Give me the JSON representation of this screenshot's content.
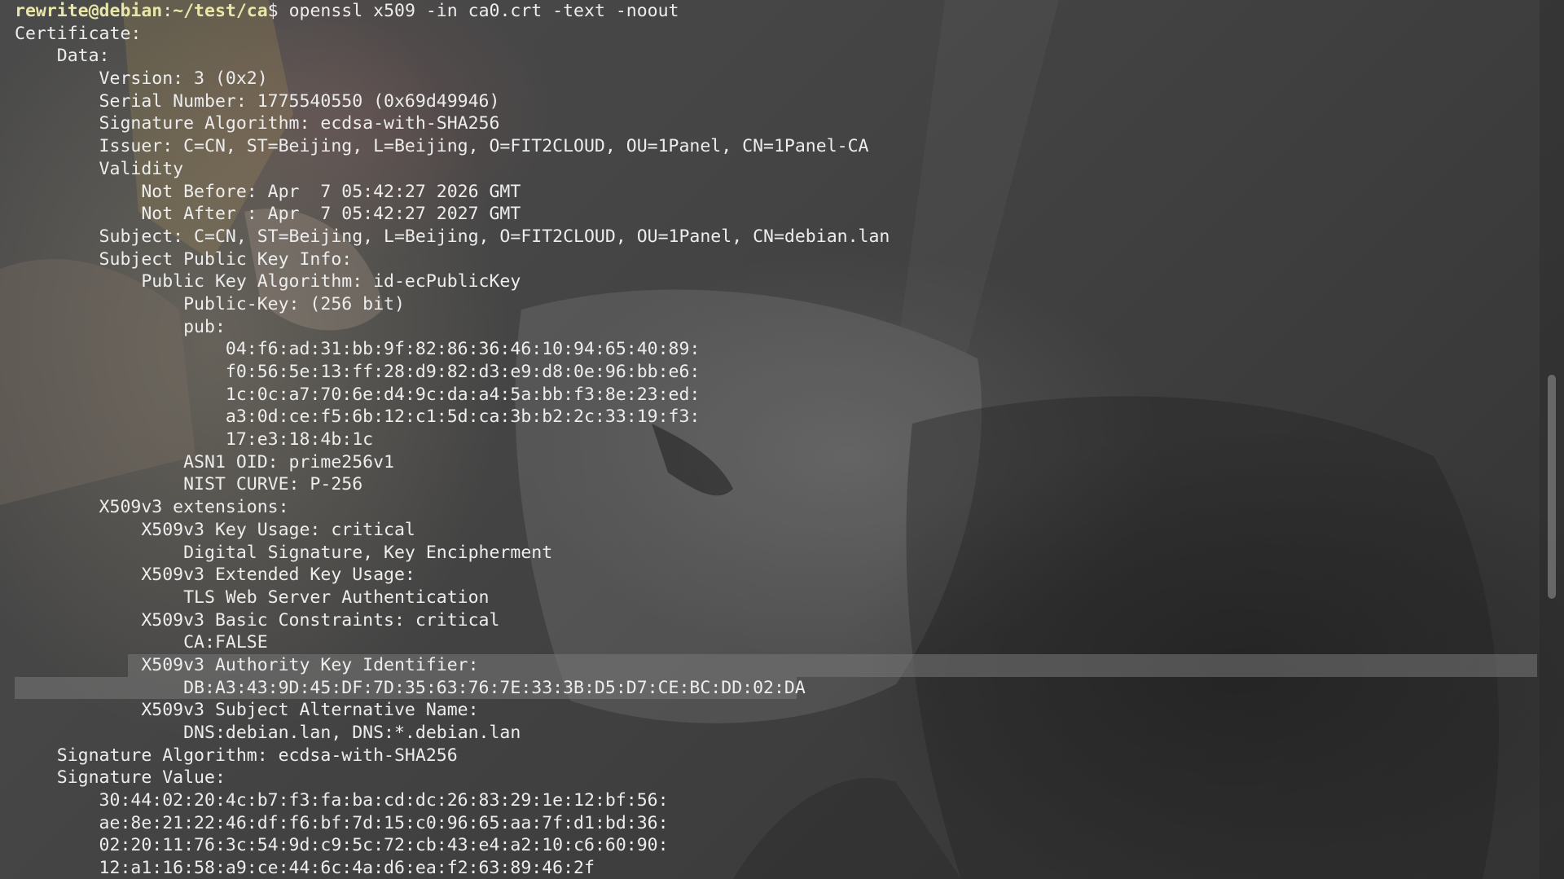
{
  "prompt": {
    "user_host": "rewrite@debian",
    "separator": ":",
    "path": "~/test/ca",
    "symbol": "$",
    "command": " openssl x509 -in ca0.crt -text -noout"
  },
  "output_lines": [
    "Certificate:",
    "    Data:",
    "        Version: 3 (0x2)",
    "        Serial Number: 1775540550 (0x69d49946)",
    "        Signature Algorithm: ecdsa-with-SHA256",
    "        Issuer: C=CN, ST=Beijing, L=Beijing, O=FIT2CLOUD, OU=1Panel, CN=1Panel-CA",
    "        Validity",
    "            Not Before: Apr  7 05:42:27 2026 GMT",
    "            Not After : Apr  7 05:42:27 2027 GMT",
    "        Subject: C=CN, ST=Beijing, L=Beijing, O=FIT2CLOUD, OU=1Panel, CN=debian.lan",
    "        Subject Public Key Info:",
    "            Public Key Algorithm: id-ecPublicKey",
    "                Public-Key: (256 bit)",
    "                pub:",
    "                    04:f6:ad:31:bb:9f:82:86:36:46:10:94:65:40:89:",
    "                    f0:56:5e:13:ff:28:d9:82:d3:e9:d8:0e:96:bb:e6:",
    "                    1c:0c:a7:70:6e:d4:9c:da:a4:5a:bb:f3:8e:23:ed:",
    "                    a3:0d:ce:f5:6b:12:c1:5d:ca:3b:b2:2c:33:19:f3:",
    "                    17:e3:18:4b:1c",
    "                ASN1 OID: prime256v1",
    "                NIST CURVE: P-256",
    "        X509v3 extensions:",
    "            X509v3 Key Usage: critical",
    "                Digital Signature, Key Encipherment",
    "            X509v3 Extended Key Usage:",
    "                TLS Web Server Authentication",
    "            X509v3 Basic Constraints: critical",
    "                CA:FALSE",
    "            X509v3 Authority Key Identifier:",
    "                DB:A3:43:9D:45:DF:7D:35:63:76:7E:33:3B:D5:D7:CE:BC:DD:02:DA",
    "            X509v3 Subject Alternative Name:",
    "                DNS:debian.lan, DNS:*.debian.lan",
    "    Signature Algorithm: ecdsa-with-SHA256",
    "    Signature Value:",
    "        30:44:02:20:4c:b7:f3:fa:ba:cd:dc:26:83:29:1e:12:bf:56:",
    "        ae:8e:21:22:46:df:f6:bf:7d:15:c0:96:65:aa:7f:d1:bd:36:",
    "        02:20:11:76:3c:54:9d:c9:5c:72:cb:43:e4:a2:10:c6:60:90:",
    "        12:a1:16:58:a9:ce:44:6c:4a:d6:ea:f2:63:89:46:2f"
  ],
  "selection": {
    "start_line_index": 28,
    "end_line_index": 29
  },
  "colors": {
    "prompt": "#e8e6a8",
    "text": "#ededed",
    "selection": "#787878",
    "background": "#3a3a3a"
  }
}
